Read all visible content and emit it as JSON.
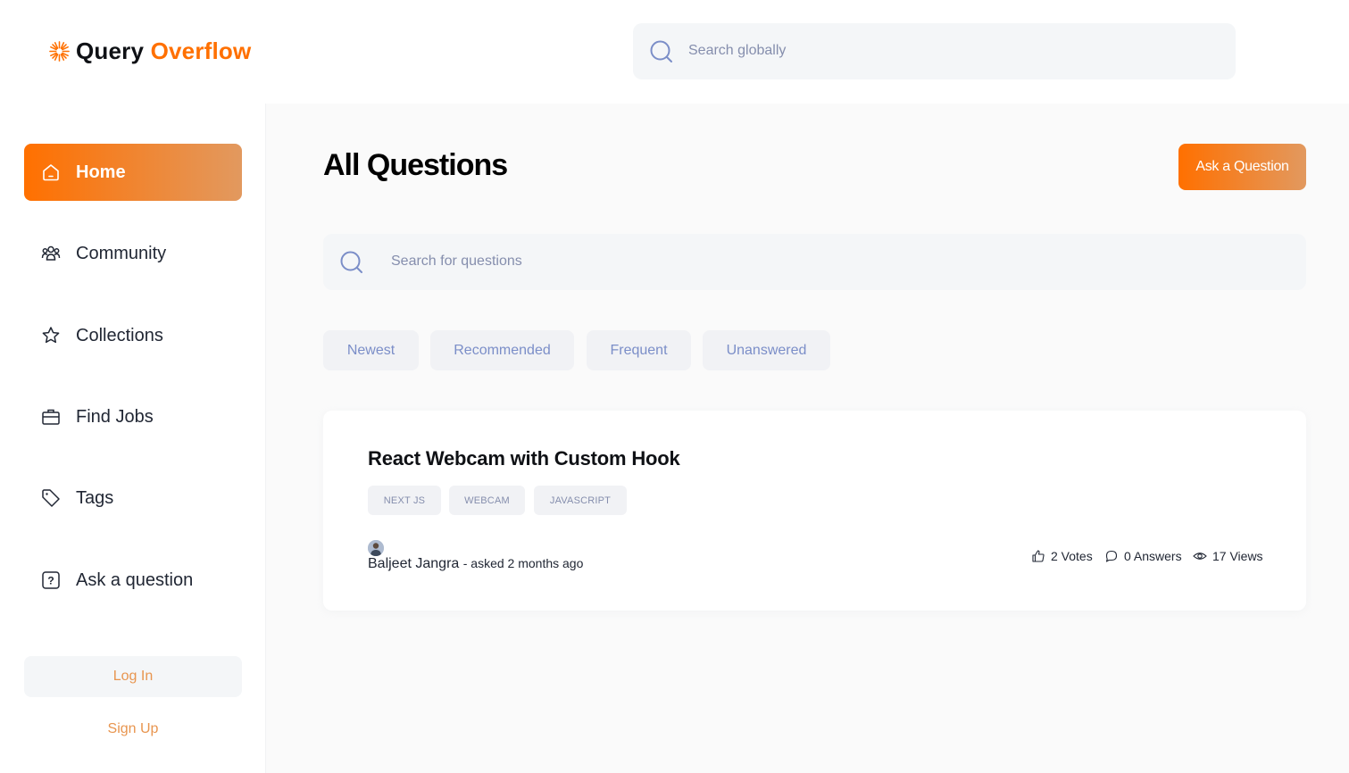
{
  "header": {
    "logo_first": "Query",
    "logo_second": "Overflow",
    "search_placeholder": "Search globally"
  },
  "sidebar": {
    "items": [
      {
        "label": "Home",
        "icon": "home-icon",
        "active": true
      },
      {
        "label": "Community",
        "icon": "users-icon",
        "active": false
      },
      {
        "label": "Collections",
        "icon": "star-icon",
        "active": false
      },
      {
        "label": "Find Jobs",
        "icon": "briefcase-icon",
        "active": false
      },
      {
        "label": "Tags",
        "icon": "tag-icon",
        "active": false
      },
      {
        "label": "Ask a question",
        "icon": "question-icon",
        "active": false
      }
    ],
    "login_label": "Log In",
    "signup_label": "Sign Up"
  },
  "main": {
    "title": "All Questions",
    "ask_button": "Ask a Question",
    "search_placeholder": "Search for questions",
    "filters": [
      "Newest",
      "Recommended",
      "Frequent",
      "Unanswered"
    ]
  },
  "questions": [
    {
      "title": "React Webcam with Custom Hook",
      "tags": [
        "NEXT JS",
        "WEBCAM",
        "JAVASCRIPT"
      ],
      "author": "Baljeet Jangra",
      "asked": "- asked 2 months ago",
      "votes": "2 Votes",
      "answers": "0 Answers",
      "views": "17 Views"
    }
  ],
  "colors": {
    "accent": "#ff7000",
    "accent_gradient_end": "#e2995f",
    "muted_text": "#858ead",
    "light_bg": "#f4f6f8"
  }
}
